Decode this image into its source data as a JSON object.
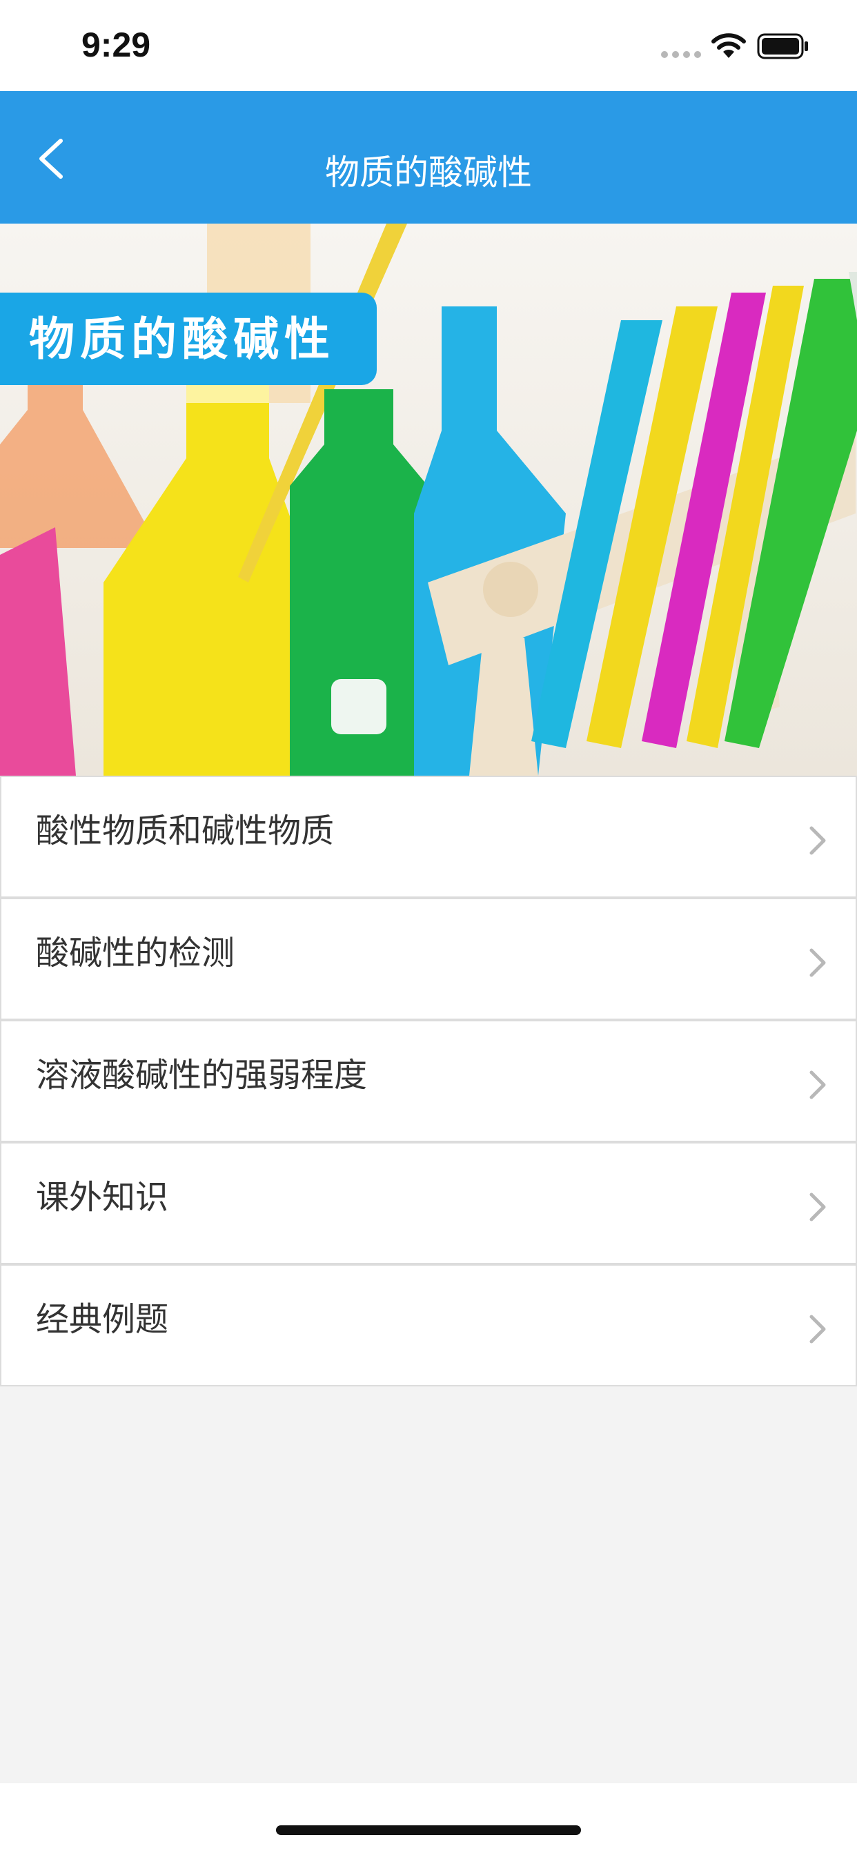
{
  "status_bar": {
    "time": "9:29"
  },
  "nav": {
    "title": "物质的酸碱性",
    "back_icon": "chevron-left-icon"
  },
  "banner": {
    "label": "物质的酸碱性"
  },
  "menu": {
    "items": [
      {
        "label": "酸性物质和碱性物质"
      },
      {
        "label": "酸碱性的检测"
      },
      {
        "label": "溶液酸碱性的强弱程度"
      },
      {
        "label": "课外知识"
      },
      {
        "label": "经典例题"
      }
    ]
  },
  "colors": {
    "nav_bg": "#2a9ae6",
    "banner_label_bg": "#1aa6e6",
    "page_bg": "#f3f3f3"
  }
}
